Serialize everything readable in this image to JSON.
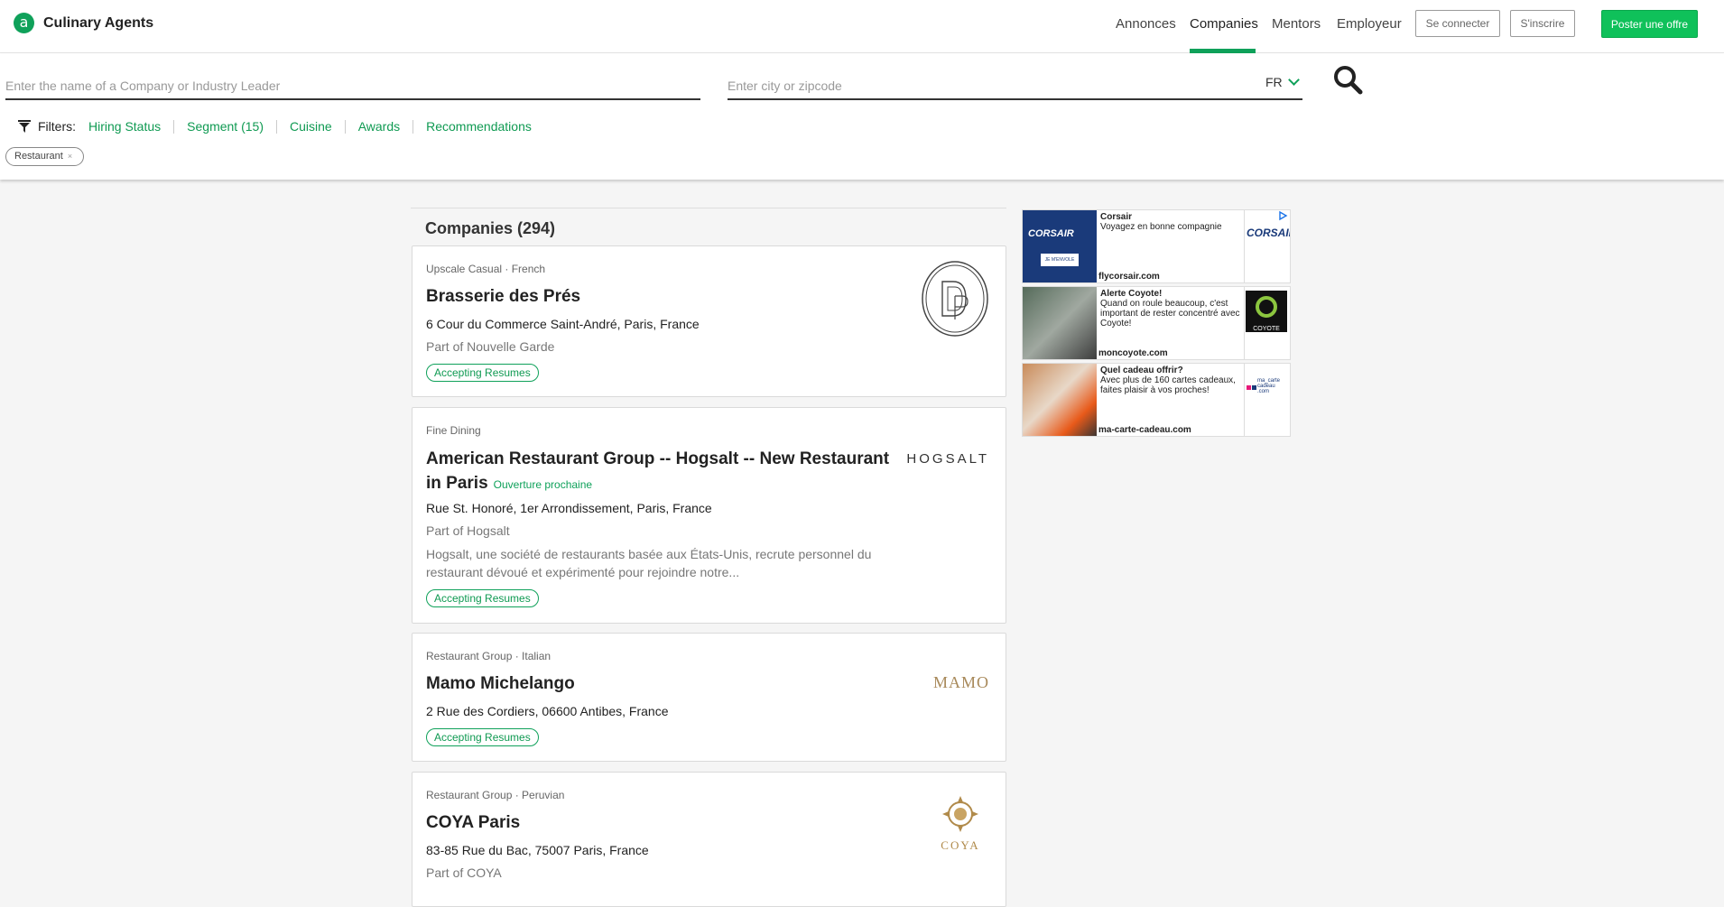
{
  "header": {
    "brand_letter": "a",
    "brand_name": "Culinary Agents",
    "nav": [
      "Annonces",
      "Companies",
      "Mentors",
      "Employeur"
    ],
    "active_nav": "Companies",
    "login_label": "Se connecter",
    "signup_label": "S'inscrire",
    "post_label": "Poster une offre"
  },
  "search": {
    "company_placeholder": "Enter the name of a Company or Industry Leader",
    "location_placeholder": "Enter city or zipcode",
    "country": "FR"
  },
  "filters": {
    "label": "Filters:",
    "links": [
      "Hiring Status",
      "Segment (15)",
      "Cuisine",
      "Awards",
      "Recommendations"
    ],
    "chip": "Restaurant"
  },
  "list": {
    "heading": "Companies (294)",
    "companies": [
      {
        "meta": "Upscale Casual · French",
        "name": "Brasserie des Prés",
        "address": "6 Cour du Commerce Saint-André, Paris, France",
        "part_of": "Part of Nouvelle Garde",
        "badge": "Accepting Resumes"
      },
      {
        "meta": "Fine Dining",
        "name": "American Restaurant Group -- Hogsalt -- New Restaurant in Paris",
        "tag": "Ouverture prochaine",
        "address": "Rue St. Honoré, 1er Arrondissement, Paris, France",
        "part_of": "Part of Hogsalt",
        "description": "Hogsalt, une société de restaurants basée aux États-Unis, recrute personnel du restaurant dévoué et expérimenté pour rejoindre notre...",
        "badge": "Accepting Resumes",
        "logo_text": "HOGSALT"
      },
      {
        "meta": "Restaurant Group · Italian",
        "name": "Mamo Michelango",
        "address": "2 Rue des Cordiers, 06600 Antibes, France",
        "badge": "Accepting Resumes",
        "logo_text": "MAMO"
      },
      {
        "meta": "Restaurant Group · Peruvian",
        "name": "COYA Paris",
        "address": "83-85 Rue du Bac, 75007 Paris, France",
        "part_of": "Part of COYA",
        "logo_text": "COYA"
      }
    ]
  },
  "ads": [
    {
      "title": "Corsair",
      "text": "Voyagez en bonne compagnie",
      "url": "flycorsair.com",
      "logo_text": "CORSAIR",
      "image_text": "CORSAIR",
      "image_button": "JE M'ENVOLE"
    },
    {
      "title": "Alerte Coyote!",
      "text": "Quand on roule beaucoup, c'est important de rester concentré avec Coyote!",
      "url": "moncoyote.com",
      "logo_text": "COYOTE"
    },
    {
      "title": "Quel cadeau offrir?",
      "text": "Avec plus de 160 cartes cadeaux, faites plaisir à vos proches!",
      "url": "ma-carte-cadeau.com",
      "logo_text": "ma_carte cadeau .com"
    }
  ],
  "colors": {
    "accent": "#0fa15a",
    "button_green": "#0fc15a"
  }
}
